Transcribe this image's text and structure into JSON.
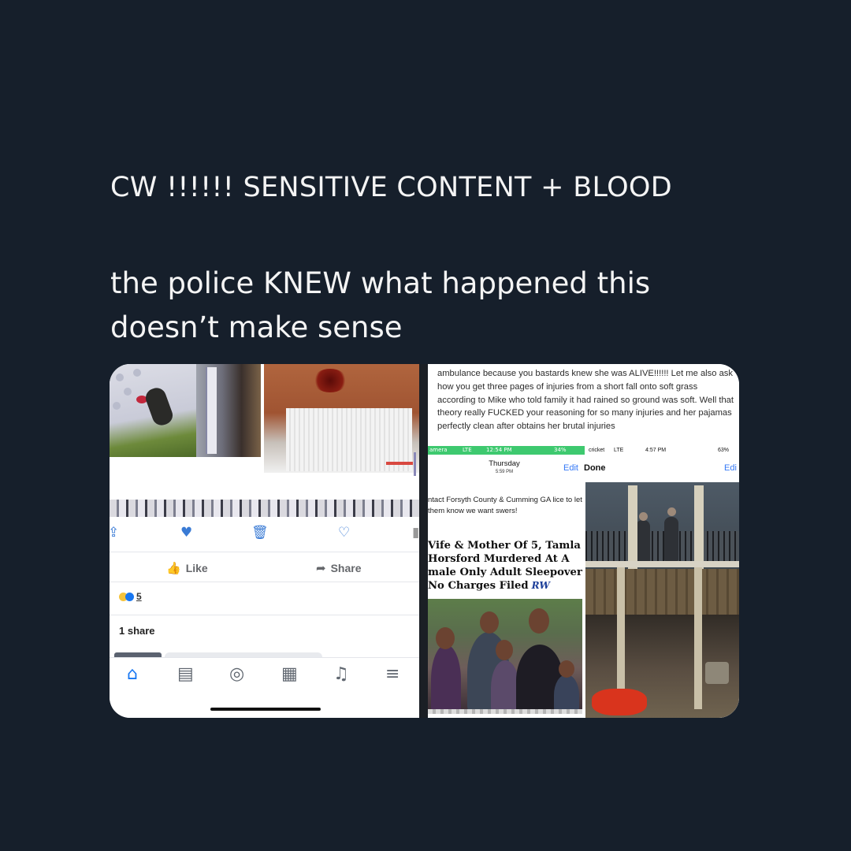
{
  "caption": {
    "content_warning": "CW !!!!!! SENSITIVE CONTENT + BLOOD",
    "body": "the police KNEW what happened this doesn’t make sense"
  },
  "left_screenshot": {
    "actions": {
      "like_label": "Like",
      "share_label": "Share"
    },
    "reaction_count": "5",
    "share_count": "1 share",
    "nav_icons": [
      "home-icon",
      "marketplace-icon",
      "groups-icon",
      "watch-icon",
      "bell-icon",
      "menu-icon"
    ],
    "accent_color": "#1877f2"
  },
  "right_screenshot": {
    "post_text": "ambulance because you bastards  knew she was ALIVE!!!!!! Let me also ask how you get three pages of injuries from a short fall onto soft grass according to Mike who told family it had rained so ground was soft. Well that theory really FUCKED your reasoning for so many injuries and her pajamas perfectly clean after obtains her brutal injuries",
    "status_left": {
      "carrier": "amera",
      "network": "LTE",
      "time": "12:54 PM",
      "battery": "34%"
    },
    "status_right": {
      "carrier": "cricket",
      "network": "LTE",
      "time": "4:57 PM",
      "battery": "63%"
    },
    "note_day": "Thursday",
    "note_time": "5:59 PM",
    "edit_left": "Edit",
    "done_right": "Done",
    "edit_right": "Edi",
    "contact_text": "ntact Forsyth County & Cumming GA lice to let them know we want swers!",
    "headline": "Vife & Mother Of 5, Tamla Horsford Murdered At A male Only Adult Sleepover No Charges Filed",
    "logo": "RW"
  }
}
